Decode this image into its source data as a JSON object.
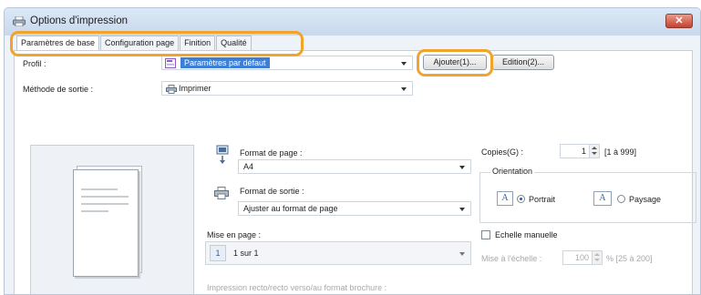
{
  "window": {
    "title": "Options d'impression",
    "close_glyph": "✕"
  },
  "tabs": [
    {
      "label": "Paramètres de base",
      "active": true
    },
    {
      "label": "Configuration page",
      "active": false
    },
    {
      "label": "Finition",
      "active": false
    },
    {
      "label": "Qualité",
      "active": false
    }
  ],
  "profile": {
    "label": "Profil :",
    "value": "Paramètres par défaut"
  },
  "buttons": {
    "add": "Ajouter(1)...",
    "edit": "Edition(2)..."
  },
  "output_method": {
    "label": "Méthode de sortie :",
    "value": "Imprimer"
  },
  "page_size": {
    "label": "Format de page :",
    "value": "A4"
  },
  "output_size": {
    "label": "Format de sortie :",
    "value": "Ajuster au format de page"
  },
  "layout": {
    "label": "Mise en page :",
    "value": "1 sur 1",
    "page_number": "1"
  },
  "duplex": {
    "label": "Impression recto/recto verso/au format brochure :"
  },
  "copies": {
    "label": "Copies(G) :",
    "value": "1",
    "range": "[1 à 999]"
  },
  "orientation": {
    "legend": "Orientation",
    "portrait": "Portrait",
    "landscape": "Paysage",
    "selected": "portrait",
    "icon_letter": "A"
  },
  "manual_scale": {
    "label": "Echelle manuelle",
    "checked": false
  },
  "scale": {
    "label": "Mise à l'échelle :",
    "value": "100",
    "range": "% [25 à 200]"
  },
  "colors": {
    "highlight": "#f2a32b",
    "selection": "#3d7fd6"
  },
  "icons": [
    "printer-icon",
    "close-icon",
    "profile-icon",
    "page-size-icon",
    "output-size-icon",
    "layout-icon"
  ]
}
